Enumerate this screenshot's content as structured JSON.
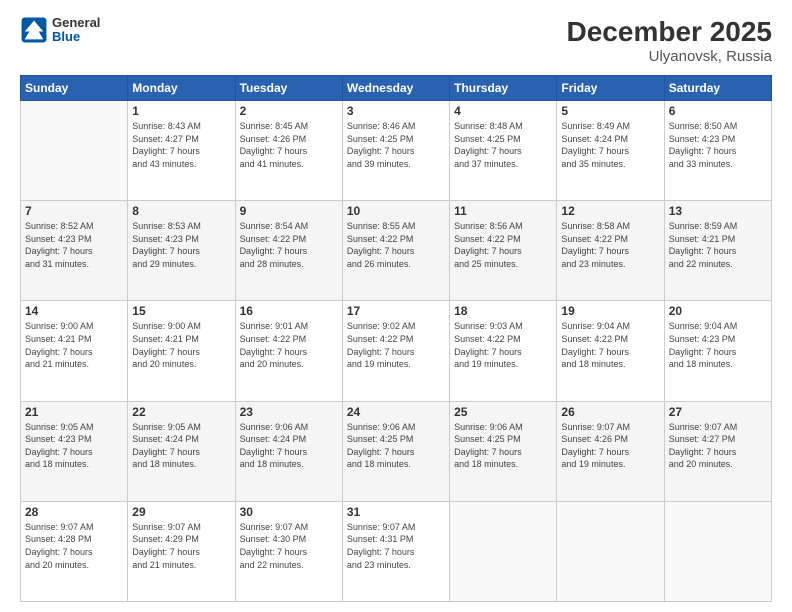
{
  "logo": {
    "line1": "General",
    "line2": "Blue"
  },
  "title": "December 2025",
  "subtitle": "Ulyanovsk, Russia",
  "days_header": [
    "Sunday",
    "Monday",
    "Tuesday",
    "Wednesday",
    "Thursday",
    "Friday",
    "Saturday"
  ],
  "weeks": [
    [
      {
        "day": "",
        "info": ""
      },
      {
        "day": "1",
        "info": "Sunrise: 8:43 AM\nSunset: 4:27 PM\nDaylight: 7 hours\nand 43 minutes."
      },
      {
        "day": "2",
        "info": "Sunrise: 8:45 AM\nSunset: 4:26 PM\nDaylight: 7 hours\nand 41 minutes."
      },
      {
        "day": "3",
        "info": "Sunrise: 8:46 AM\nSunset: 4:25 PM\nDaylight: 7 hours\nand 39 minutes."
      },
      {
        "day": "4",
        "info": "Sunrise: 8:48 AM\nSunset: 4:25 PM\nDaylight: 7 hours\nand 37 minutes."
      },
      {
        "day": "5",
        "info": "Sunrise: 8:49 AM\nSunset: 4:24 PM\nDaylight: 7 hours\nand 35 minutes."
      },
      {
        "day": "6",
        "info": "Sunrise: 8:50 AM\nSunset: 4:23 PM\nDaylight: 7 hours\nand 33 minutes."
      }
    ],
    [
      {
        "day": "7",
        "info": "Sunrise: 8:52 AM\nSunset: 4:23 PM\nDaylight: 7 hours\nand 31 minutes."
      },
      {
        "day": "8",
        "info": "Sunrise: 8:53 AM\nSunset: 4:23 PM\nDaylight: 7 hours\nand 29 minutes."
      },
      {
        "day": "9",
        "info": "Sunrise: 8:54 AM\nSunset: 4:22 PM\nDaylight: 7 hours\nand 28 minutes."
      },
      {
        "day": "10",
        "info": "Sunrise: 8:55 AM\nSunset: 4:22 PM\nDaylight: 7 hours\nand 26 minutes."
      },
      {
        "day": "11",
        "info": "Sunrise: 8:56 AM\nSunset: 4:22 PM\nDaylight: 7 hours\nand 25 minutes."
      },
      {
        "day": "12",
        "info": "Sunrise: 8:58 AM\nSunset: 4:22 PM\nDaylight: 7 hours\nand 23 minutes."
      },
      {
        "day": "13",
        "info": "Sunrise: 8:59 AM\nSunset: 4:21 PM\nDaylight: 7 hours\nand 22 minutes."
      }
    ],
    [
      {
        "day": "14",
        "info": "Sunrise: 9:00 AM\nSunset: 4:21 PM\nDaylight: 7 hours\nand 21 minutes."
      },
      {
        "day": "15",
        "info": "Sunrise: 9:00 AM\nSunset: 4:21 PM\nDaylight: 7 hours\nand 20 minutes."
      },
      {
        "day": "16",
        "info": "Sunrise: 9:01 AM\nSunset: 4:22 PM\nDaylight: 7 hours\nand 20 minutes."
      },
      {
        "day": "17",
        "info": "Sunrise: 9:02 AM\nSunset: 4:22 PM\nDaylight: 7 hours\nand 19 minutes."
      },
      {
        "day": "18",
        "info": "Sunrise: 9:03 AM\nSunset: 4:22 PM\nDaylight: 7 hours\nand 19 minutes."
      },
      {
        "day": "19",
        "info": "Sunrise: 9:04 AM\nSunset: 4:22 PM\nDaylight: 7 hours\nand 18 minutes."
      },
      {
        "day": "20",
        "info": "Sunrise: 9:04 AM\nSunset: 4:23 PM\nDaylight: 7 hours\nand 18 minutes."
      }
    ],
    [
      {
        "day": "21",
        "info": "Sunrise: 9:05 AM\nSunset: 4:23 PM\nDaylight: 7 hours\nand 18 minutes."
      },
      {
        "day": "22",
        "info": "Sunrise: 9:05 AM\nSunset: 4:24 PM\nDaylight: 7 hours\nand 18 minutes."
      },
      {
        "day": "23",
        "info": "Sunrise: 9:06 AM\nSunset: 4:24 PM\nDaylight: 7 hours\nand 18 minutes."
      },
      {
        "day": "24",
        "info": "Sunrise: 9:06 AM\nSunset: 4:25 PM\nDaylight: 7 hours\nand 18 minutes."
      },
      {
        "day": "25",
        "info": "Sunrise: 9:06 AM\nSunset: 4:25 PM\nDaylight: 7 hours\nand 18 minutes."
      },
      {
        "day": "26",
        "info": "Sunrise: 9:07 AM\nSunset: 4:26 PM\nDaylight: 7 hours\nand 19 minutes."
      },
      {
        "day": "27",
        "info": "Sunrise: 9:07 AM\nSunset: 4:27 PM\nDaylight: 7 hours\nand 20 minutes."
      }
    ],
    [
      {
        "day": "28",
        "info": "Sunrise: 9:07 AM\nSunset: 4:28 PM\nDaylight: 7 hours\nand 20 minutes."
      },
      {
        "day": "29",
        "info": "Sunrise: 9:07 AM\nSunset: 4:29 PM\nDaylight: 7 hours\nand 21 minutes."
      },
      {
        "day": "30",
        "info": "Sunrise: 9:07 AM\nSunset: 4:30 PM\nDaylight: 7 hours\nand 22 minutes."
      },
      {
        "day": "31",
        "info": "Sunrise: 9:07 AM\nSunset: 4:31 PM\nDaylight: 7 hours\nand 23 minutes."
      },
      {
        "day": "",
        "info": ""
      },
      {
        "day": "",
        "info": ""
      },
      {
        "day": "",
        "info": ""
      }
    ]
  ]
}
